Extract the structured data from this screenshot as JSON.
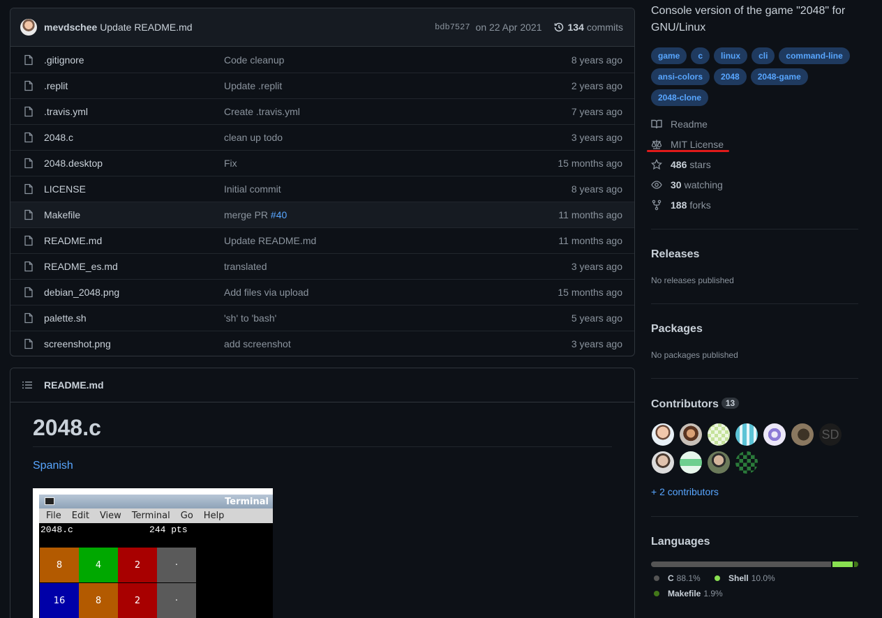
{
  "commit": {
    "author": "mevdschee",
    "message": "Update README.md",
    "sha": "bdb7527",
    "date": "on 22 Apr 2021",
    "count": "134",
    "count_label": "commits"
  },
  "files": [
    {
      "name": ".gitignore",
      "message": "Code cleanup",
      "age": "8 years ago"
    },
    {
      "name": ".replit",
      "message": "Update .replit",
      "age": "2 years ago"
    },
    {
      "name": ".travis.yml",
      "message": "Create .travis.yml",
      "age": "7 years ago"
    },
    {
      "name": "2048.c",
      "message": "clean up todo",
      "age": "3 years ago"
    },
    {
      "name": "2048.desktop",
      "message": "Fix",
      "age": "15 months ago"
    },
    {
      "name": "LICENSE",
      "message": "Initial commit",
      "age": "8 years ago"
    },
    {
      "name": "Makefile",
      "message": "merge PR ",
      "message_link": "#40",
      "age": "11 months ago"
    },
    {
      "name": "README.md",
      "message": "Update README.md",
      "age": "11 months ago"
    },
    {
      "name": "README_es.md",
      "message": "translated",
      "age": "3 years ago"
    },
    {
      "name": "debian_2048.png",
      "message": "Add files via upload",
      "age": "15 months ago"
    },
    {
      "name": "palette.sh",
      "message": "'sh' to 'bash'",
      "age": "5 years ago"
    },
    {
      "name": "screenshot.png",
      "message": "add screenshot",
      "age": "3 years ago"
    }
  ],
  "readme": {
    "header": "README.md",
    "h1": "2048.c",
    "link": "Spanish",
    "terminal": {
      "title": "Terminal",
      "menu": [
        "File",
        "Edit",
        "View",
        "Terminal",
        "Go",
        "Help"
      ],
      "status_line": "2048.c              244 pts",
      "tiles": [
        {
          "value": "8",
          "color": "#b35a00"
        },
        {
          "value": "4",
          "color": "#00a800"
        },
        {
          "value": "2",
          "color": "#a80000"
        },
        {
          "value": "·",
          "color": "#5a5a5a"
        },
        {
          "value": "16",
          "color": "#0000a8"
        },
        {
          "value": "8",
          "color": "#b35a00"
        },
        {
          "value": "2",
          "color": "#a80000"
        },
        {
          "value": "·",
          "color": "#5a5a5a"
        }
      ]
    }
  },
  "sidebar": {
    "about": "Console version of the game \"2048\" for GNU/Linux",
    "topics": [
      "game",
      "c",
      "linux",
      "cli",
      "command-line",
      "ansi-colors",
      "2048",
      "2048-game",
      "2048-clone"
    ],
    "readme_label": "Readme",
    "license_label": "MIT License",
    "stars": "486",
    "stars_label": "stars",
    "watching": "30",
    "watching_label": "watching",
    "forks": "188",
    "forks_label": "forks",
    "releases_title": "Releases",
    "releases_sub": "No releases published",
    "packages_title": "Packages",
    "packages_sub": "No packages published",
    "contributors_title": "Contributors",
    "contributors_count": "13",
    "contributor_initials": "SD",
    "more_contributors": "+ 2 contributors",
    "languages_title": "Languages",
    "languages": [
      {
        "name": "C",
        "percent": "88.1%",
        "share": 88.1,
        "color": "#555555"
      },
      {
        "name": "Shell",
        "percent": "10.0%",
        "share": 10.0,
        "color": "#89e051"
      },
      {
        "name": "Makefile",
        "percent": "1.9%",
        "share": 1.9,
        "color": "#427819"
      }
    ]
  },
  "colors": {
    "accent": "#58a6ff",
    "bg": "#0d1117",
    "annotation": "#e01a1a"
  }
}
